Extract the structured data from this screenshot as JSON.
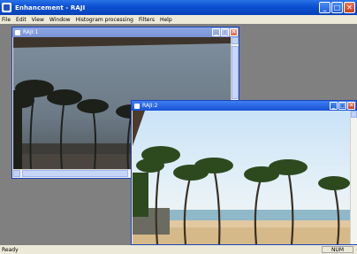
{
  "app": {
    "title": "Enhancement - RAJI",
    "buttons": [
      "_",
      "□",
      "✕"
    ]
  },
  "menu": [
    "File",
    "Edit",
    "View",
    "Window",
    "Histogram processing",
    "Filters",
    "Help"
  ],
  "windows": [
    {
      "title": "RAJI:1",
      "state": "inactive"
    },
    {
      "title": "RAJI:2",
      "state": "active"
    }
  ],
  "status": {
    "left": "Ready",
    "right": "NUM"
  }
}
